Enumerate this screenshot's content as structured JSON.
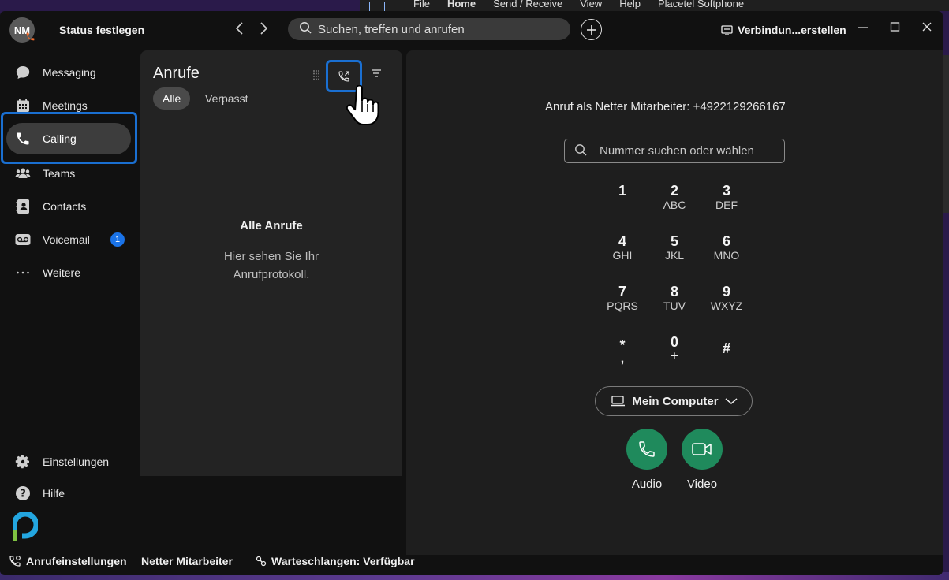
{
  "background_app": {
    "menu": [
      "File",
      "Home",
      "Send / Receive",
      "View",
      "Help",
      "Placetel Softphone"
    ]
  },
  "titlebar": {
    "avatar_initials": "NM",
    "status_label": "Status festlegen",
    "search_placeholder": "Suchen, treffen und anrufen",
    "connect_label": "Verbindun...erstellen"
  },
  "nav": {
    "items": [
      {
        "label": "Messaging",
        "icon": "chat-icon"
      },
      {
        "label": "Meetings",
        "icon": "calendar-icon"
      },
      {
        "label": "Calling",
        "icon": "phone-icon",
        "active": true
      },
      {
        "label": "Teams",
        "icon": "people-icon"
      },
      {
        "label": "Contacts",
        "icon": "contacts-icon"
      },
      {
        "label": "Voicemail",
        "icon": "voicemail-icon",
        "badge": "1"
      },
      {
        "label": "Weitere",
        "icon": "more-icon"
      }
    ],
    "settings_label": "Einstellungen",
    "help_label": "Hilfe"
  },
  "calls": {
    "title": "Anrufe",
    "filters": [
      "Alle",
      "Verpasst"
    ],
    "active_filter": "Alle",
    "empty_title": "Alle Anrufe",
    "empty_text": "Hier sehen Sie Ihr Anrufprotokoll."
  },
  "dialpad": {
    "caller_id": "Anruf als Netter Mitarbeiter: +4922129266167",
    "search_placeholder": "Nummer suchen oder wählen",
    "keys": [
      {
        "num": "1",
        "sub": ""
      },
      {
        "num": "2",
        "sub": "ABC"
      },
      {
        "num": "3",
        "sub": "DEF"
      },
      {
        "num": "4",
        "sub": "GHI"
      },
      {
        "num": "5",
        "sub": "JKL"
      },
      {
        "num": "6",
        "sub": "MNO"
      },
      {
        "num": "7",
        "sub": "PQRS"
      },
      {
        "num": "8",
        "sub": "TUV"
      },
      {
        "num": "9",
        "sub": "WXYZ"
      },
      {
        "num": "*",
        "sub": ","
      },
      {
        "num": "0",
        "sub": "+"
      },
      {
        "num": "#",
        "sub": ""
      }
    ],
    "device_label": "Mein Computer",
    "audio_label": "Audio",
    "video_label": "Video"
  },
  "statusbar": {
    "call_settings": "Anrufeinstellungen",
    "user_name": "Netter Mitarbeiter",
    "queue_status": "Warteschlangen: Verfügbar"
  },
  "colors": {
    "accent_highlight": "#1a6fd1",
    "call_green": "#1f8a5c",
    "badge_blue": "#1a73e8",
    "presence_orange": "#f36b2b"
  }
}
